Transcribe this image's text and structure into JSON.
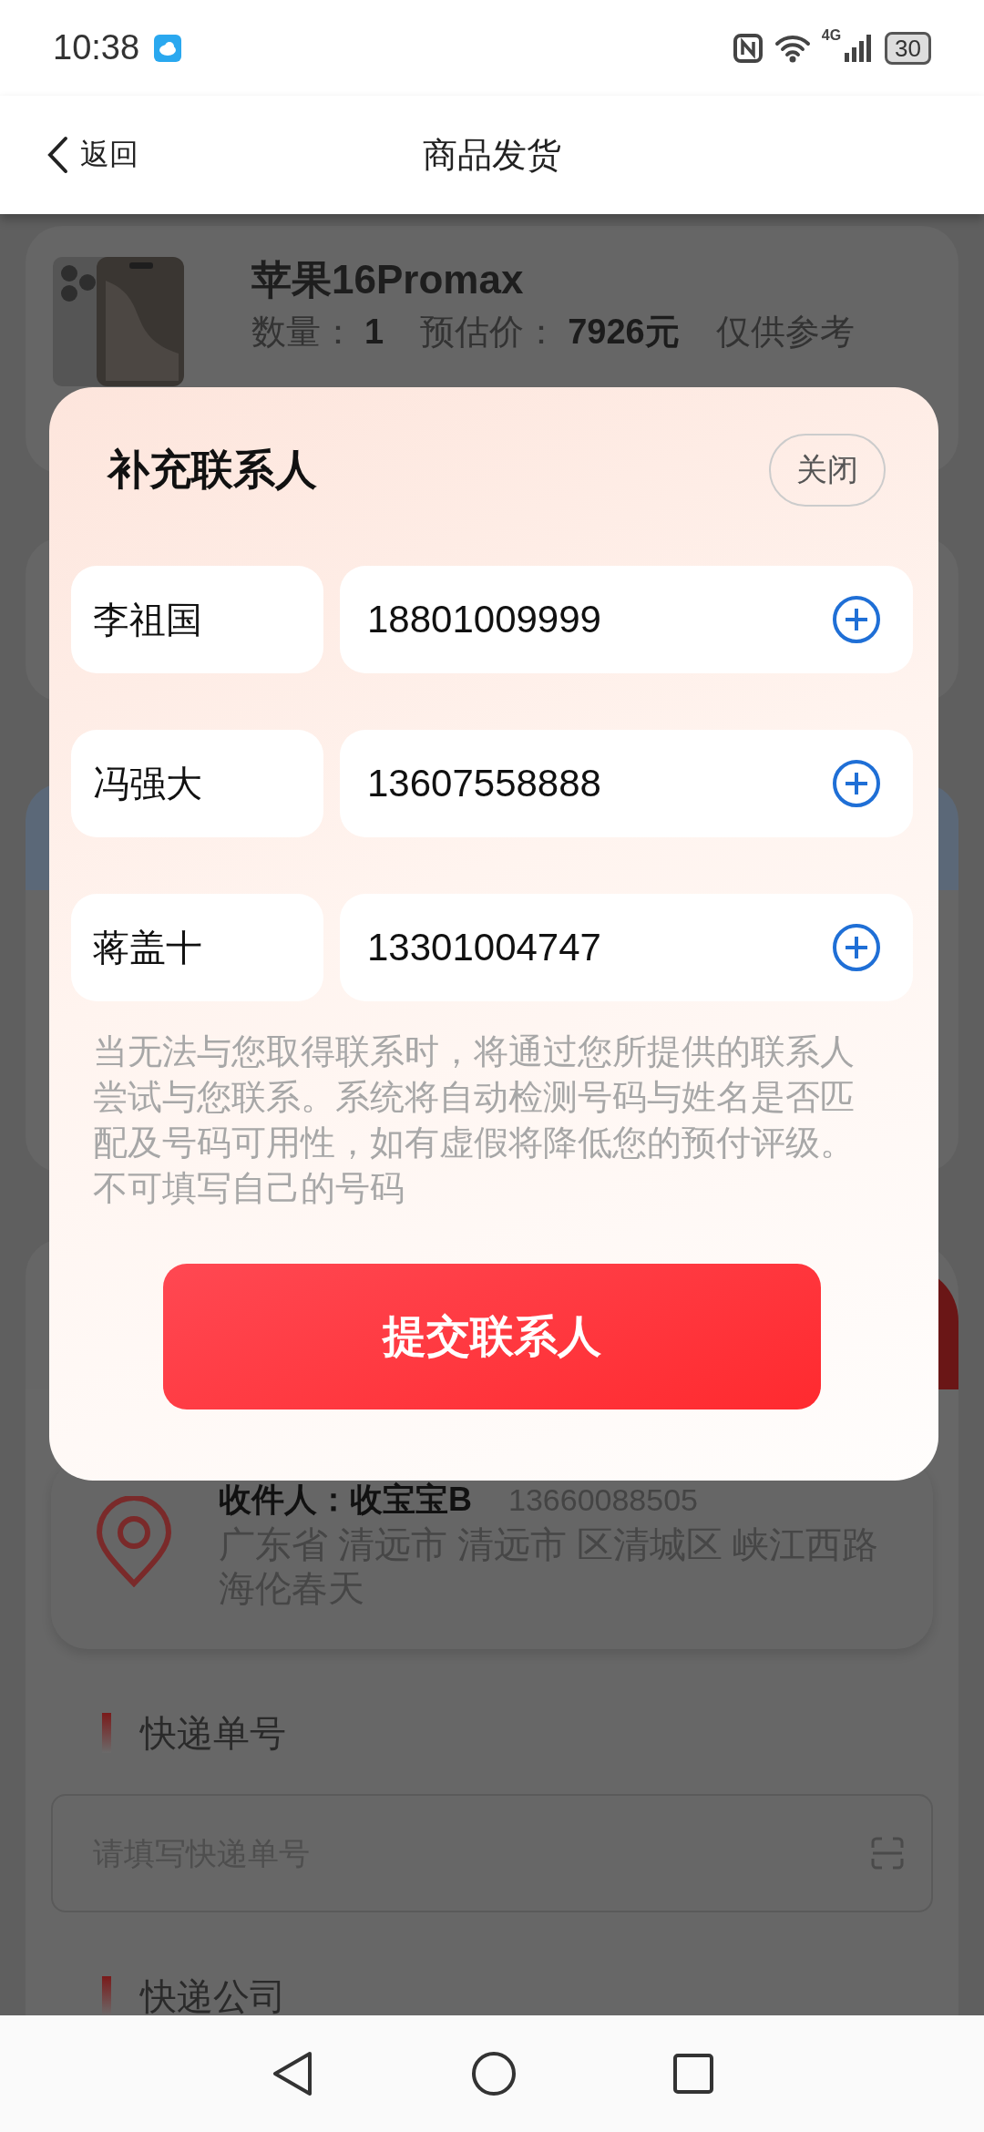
{
  "status_bar": {
    "time": "10:38",
    "network": "4G",
    "battery": "30"
  },
  "nav": {
    "back": "返回",
    "title": "商品发货"
  },
  "product": {
    "name": "苹果16Promax",
    "quantity_label": "数量：",
    "quantity": "1",
    "price_label": "预估价：",
    "price": "7926元",
    "note": "仅供参考"
  },
  "address": {
    "recipient": "收件人：收宝宝B",
    "phone": "13660088505",
    "address": "广东省 清远市 清远市 区清城区 峡江西路海伦春天"
  },
  "tracking": {
    "label": "快递单号",
    "placeholder": "请填写快递单号"
  },
  "courier": {
    "label": "快递公司"
  },
  "dialog": {
    "title": "补充联系人",
    "close": "关闭",
    "contacts": [
      {
        "name": "李祖国",
        "phone": "18801009999"
      },
      {
        "name": "冯强大",
        "phone": "13607558888"
      },
      {
        "name": "蒋盖十",
        "phone": "13301004747"
      }
    ],
    "notice": "当无法与您取得联系时，将通过您所提供的联系人尝试与您联系。系统将自动检测号码与姓名是否匹配及号码可用性，如有虚假将降低您的预付评级。不可填写自己的号码",
    "submit": "提交联系人"
  }
}
